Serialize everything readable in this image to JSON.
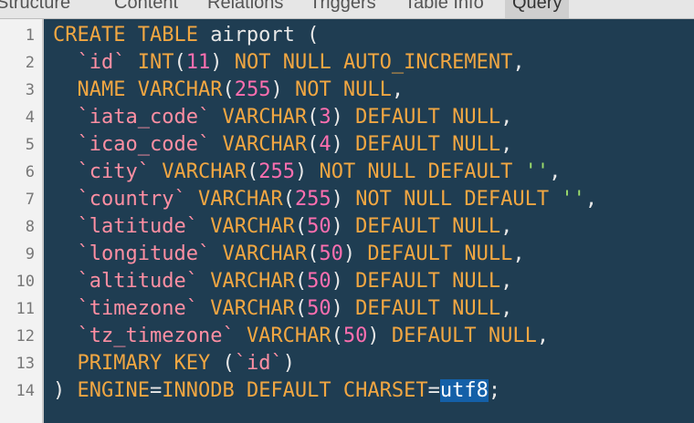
{
  "tabs": [
    {
      "label": "Structure",
      "active": false
    },
    {
      "label": "Content",
      "active": false
    },
    {
      "label": "Relations",
      "active": false
    },
    {
      "label": "Triggers",
      "active": false
    },
    {
      "label": "Table Info",
      "active": false
    },
    {
      "label": "Query",
      "active": true
    }
  ],
  "line_numbers": [
    "1",
    "2",
    "3",
    "4",
    "5",
    "6",
    "7",
    "8",
    "9",
    "10",
    "11",
    "12",
    "13",
    "14"
  ],
  "lines": [
    [
      [
        "kw",
        "CREATE TABLE "
      ],
      [
        "ident",
        "airport "
      ],
      [
        "punc",
        "("
      ]
    ],
    [
      [
        "punc",
        "  "
      ],
      [
        "bt",
        "`id`"
      ],
      [
        "punc",
        " "
      ],
      [
        "kw",
        "INT"
      ],
      [
        "punc",
        "("
      ],
      [
        "num",
        "11"
      ],
      [
        "punc",
        ") "
      ],
      [
        "kw",
        "NOT NULL AUTO_INCREMENT"
      ],
      [
        "punc",
        ","
      ]
    ],
    [
      [
        "punc",
        "  "
      ],
      [
        "kw",
        "NAME VARCHAR"
      ],
      [
        "punc",
        "("
      ],
      [
        "num",
        "255"
      ],
      [
        "punc",
        ") "
      ],
      [
        "kw",
        "NOT NULL"
      ],
      [
        "punc",
        ","
      ]
    ],
    [
      [
        "punc",
        "  "
      ],
      [
        "bt",
        "`iata_code`"
      ],
      [
        "punc",
        " "
      ],
      [
        "kw",
        "VARCHAR"
      ],
      [
        "punc",
        "("
      ],
      [
        "num",
        "3"
      ],
      [
        "punc",
        ") "
      ],
      [
        "kw",
        "DEFAULT NULL"
      ],
      [
        "punc",
        ","
      ]
    ],
    [
      [
        "punc",
        "  "
      ],
      [
        "bt",
        "`icao_code`"
      ],
      [
        "punc",
        " "
      ],
      [
        "kw",
        "VARCHAR"
      ],
      [
        "punc",
        "("
      ],
      [
        "num",
        "4"
      ],
      [
        "punc",
        ") "
      ],
      [
        "kw",
        "DEFAULT NULL"
      ],
      [
        "punc",
        ","
      ]
    ],
    [
      [
        "punc",
        "  "
      ],
      [
        "bt",
        "`city`"
      ],
      [
        "punc",
        " "
      ],
      [
        "kw",
        "VARCHAR"
      ],
      [
        "punc",
        "("
      ],
      [
        "num",
        "255"
      ],
      [
        "punc",
        ") "
      ],
      [
        "kw",
        "NOT NULL DEFAULT "
      ],
      [
        "str",
        "''"
      ],
      [
        "punc",
        ","
      ]
    ],
    [
      [
        "punc",
        "  "
      ],
      [
        "bt",
        "`country`"
      ],
      [
        "punc",
        " "
      ],
      [
        "kw",
        "VARCHAR"
      ],
      [
        "punc",
        "("
      ],
      [
        "num",
        "255"
      ],
      [
        "punc",
        ") "
      ],
      [
        "kw",
        "NOT NULL DEFAULT "
      ],
      [
        "str",
        "''"
      ],
      [
        "punc",
        ","
      ]
    ],
    [
      [
        "punc",
        "  "
      ],
      [
        "bt",
        "`latitude`"
      ],
      [
        "punc",
        " "
      ],
      [
        "kw",
        "VARCHAR"
      ],
      [
        "punc",
        "("
      ],
      [
        "num",
        "50"
      ],
      [
        "punc",
        ") "
      ],
      [
        "kw",
        "DEFAULT NULL"
      ],
      [
        "punc",
        ","
      ]
    ],
    [
      [
        "punc",
        "  "
      ],
      [
        "bt",
        "`longitude`"
      ],
      [
        "punc",
        " "
      ],
      [
        "kw",
        "VARCHAR"
      ],
      [
        "punc",
        "("
      ],
      [
        "num",
        "50"
      ],
      [
        "punc",
        ") "
      ],
      [
        "kw",
        "DEFAULT NULL"
      ],
      [
        "punc",
        ","
      ]
    ],
    [
      [
        "punc",
        "  "
      ],
      [
        "bt",
        "`altitude`"
      ],
      [
        "punc",
        " "
      ],
      [
        "kw",
        "VARCHAR"
      ],
      [
        "punc",
        "("
      ],
      [
        "num",
        "50"
      ],
      [
        "punc",
        ") "
      ],
      [
        "kw",
        "DEFAULT NULL"
      ],
      [
        "punc",
        ","
      ]
    ],
    [
      [
        "punc",
        "  "
      ],
      [
        "bt",
        "`timezone`"
      ],
      [
        "punc",
        " "
      ],
      [
        "kw",
        "VARCHAR"
      ],
      [
        "punc",
        "("
      ],
      [
        "num",
        "50"
      ],
      [
        "punc",
        ") "
      ],
      [
        "kw",
        "DEFAULT NULL"
      ],
      [
        "punc",
        ","
      ]
    ],
    [
      [
        "punc",
        "  "
      ],
      [
        "bt",
        "`tz_timezone`"
      ],
      [
        "punc",
        " "
      ],
      [
        "kw",
        "VARCHAR"
      ],
      [
        "punc",
        "("
      ],
      [
        "num",
        "50"
      ],
      [
        "punc",
        ") "
      ],
      [
        "kw",
        "DEFAULT NULL"
      ],
      [
        "punc",
        ","
      ]
    ],
    [
      [
        "punc",
        "  "
      ],
      [
        "kw",
        "PRIMARY KEY "
      ],
      [
        "punc",
        "("
      ],
      [
        "bt",
        "`id`"
      ],
      [
        "punc",
        ")"
      ]
    ],
    [
      [
        "punc",
        ") "
      ],
      [
        "kw",
        "ENGINE"
      ],
      [
        "punc",
        "="
      ],
      [
        "kw",
        "INNODB DEFAULT CHARSET"
      ],
      [
        "punc",
        "="
      ],
      [
        "sel",
        "utf8"
      ],
      [
        "punc",
        ";"
      ]
    ]
  ]
}
